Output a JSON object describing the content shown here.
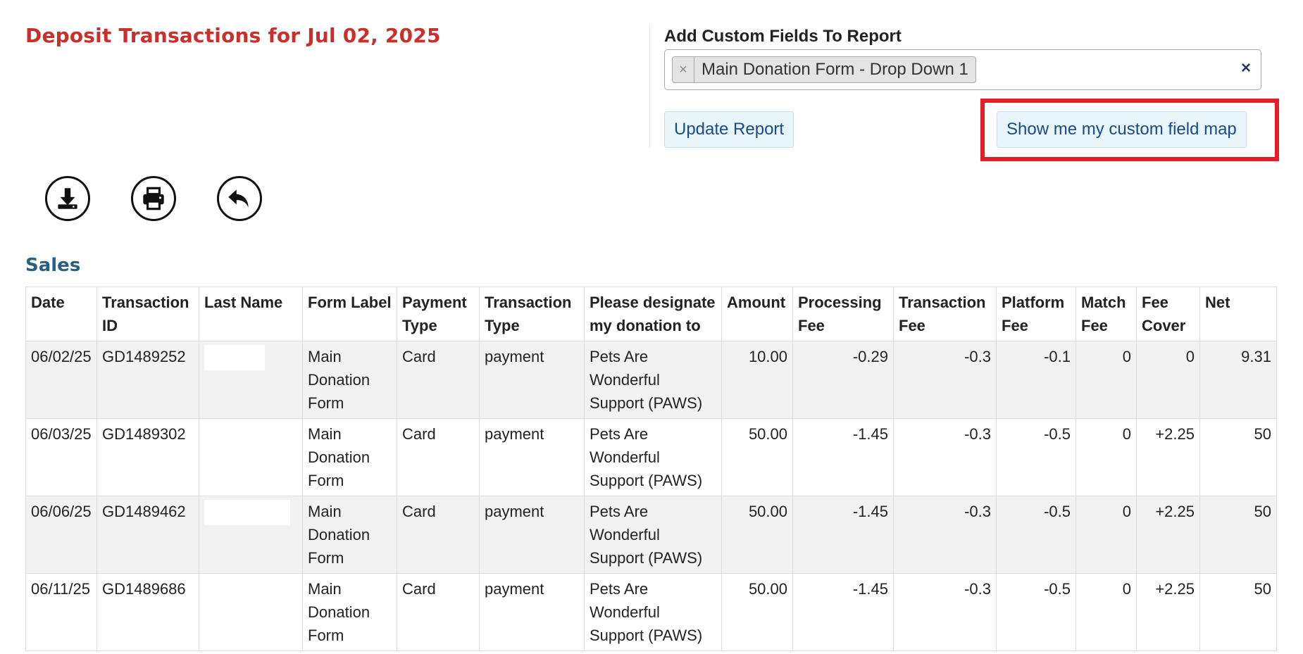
{
  "page": {
    "title": "Deposit Transactions for Jul 02, 2025"
  },
  "custom_fields": {
    "label": "Add Custom Fields To Report",
    "selected_tags": [
      "Main Donation Form - Drop Down 1"
    ],
    "tag_remove_glyph": "×",
    "clear_glyph": "×",
    "update_label": "Update Report",
    "map_label": "Show me my custom field map"
  },
  "toolbar": {
    "icons": [
      "download-icon",
      "print-icon",
      "back-icon"
    ]
  },
  "sales": {
    "title": "Sales",
    "columns": [
      "Date",
      "Transaction ID",
      "Last Name",
      "Form Label",
      "Payment Type",
      "Transaction Type",
      "Please designate my donation to",
      "Amount",
      "Processing Fee",
      "Transaction Fee",
      "Platform Fee",
      "Match Fee",
      "Fee Cover",
      "Net"
    ],
    "rows": [
      [
        "06/02/25",
        "GD1489252",
        "",
        "Main Donation Form",
        "Card",
        "payment",
        "Pets Are Wonderful Support (PAWS)",
        "10.00",
        "-0.29",
        "-0.3",
        "-0.1",
        "0",
        "0",
        "9.31"
      ],
      [
        "06/03/25",
        "GD1489302",
        "",
        "Main Donation Form",
        "Card",
        "payment",
        "Pets Are Wonderful Support (PAWS)",
        "50.00",
        "-1.45",
        "-0.3",
        "-0.5",
        "0",
        "+2.25",
        "50"
      ],
      [
        "06/06/25",
        "GD1489462",
        "",
        "Main Donation Form",
        "Card",
        "payment",
        "Pets Are Wonderful Support (PAWS)",
        "50.00",
        "-1.45",
        "-0.3",
        "-0.5",
        "0",
        "+2.25",
        "50"
      ],
      [
        "06/11/25",
        "GD1489686",
        "",
        "Main Donation Form",
        "Card",
        "payment",
        "Pets Are Wonderful Support (PAWS)",
        "50.00",
        "-1.45",
        "-0.3",
        "-0.5",
        "0",
        "+2.25",
        "50"
      ]
    ]
  },
  "colors": {
    "title_red": "#c9302c",
    "section_blue": "#2a5f7f",
    "button_bg": "#e8f6fb",
    "button_text": "#1a4a8a",
    "highlight_red": "#e31e24",
    "row_stripe": "#f2f2f2"
  }
}
